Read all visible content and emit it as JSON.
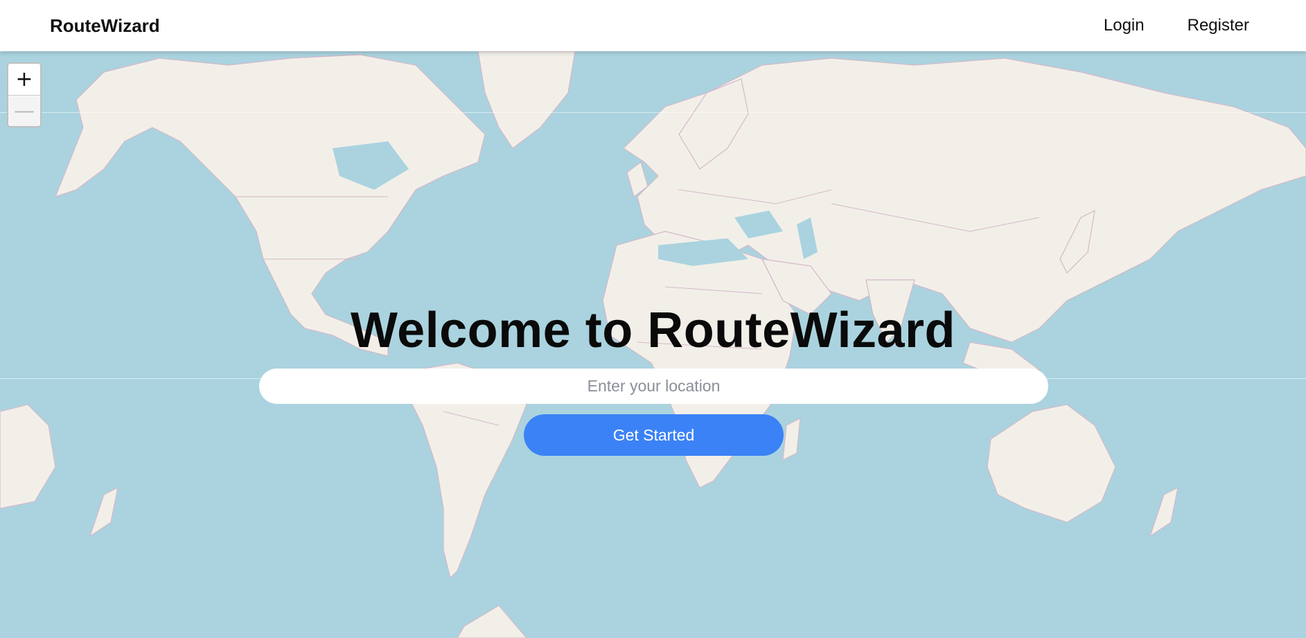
{
  "header": {
    "brand": "RouteWizard",
    "nav": {
      "login": "Login",
      "register": "Register"
    }
  },
  "map": {
    "zoom_in": "+",
    "zoom_out": "—",
    "land_color": "#f2efe9",
    "water_color": "#aad3df",
    "border_color": "#d4b8c8"
  },
  "hero": {
    "title": "Welcome to RouteWizard",
    "search_placeholder": "Enter your location",
    "cta_label": "Get Started",
    "cta_color": "#3b82f6"
  }
}
